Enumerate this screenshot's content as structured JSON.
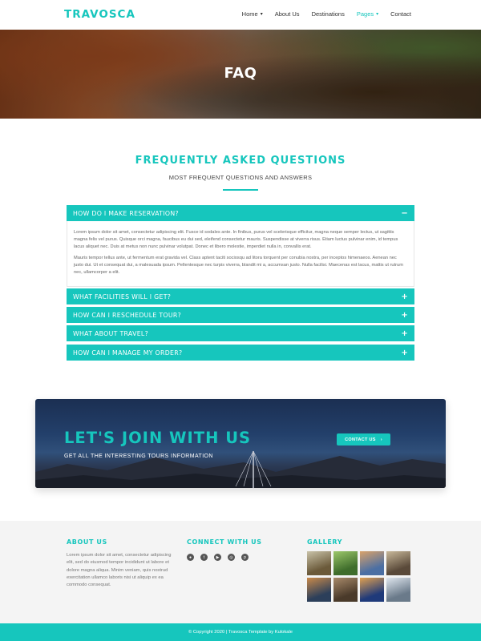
{
  "brand": {
    "logo": "TRAVOSCA",
    "accent": "#16c6bd"
  },
  "nav": {
    "items": [
      {
        "label": "Home",
        "caret": true,
        "active": false
      },
      {
        "label": "About Us",
        "caret": false,
        "active": false
      },
      {
        "label": "Destinations",
        "caret": false,
        "active": false
      },
      {
        "label": "Pages",
        "caret": true,
        "active": true
      },
      {
        "label": "Contact",
        "caret": false,
        "active": false
      }
    ]
  },
  "hero": {
    "title": "FAQ"
  },
  "faq": {
    "title": "FREQUENTLY ASKED QUESTIONS",
    "subtitle": "MOST FREQUENT QUESTIONS AND ANSWERS",
    "items": [
      {
        "question": "HOW DO I MAKE RESERVATION?",
        "sign": "−",
        "open": true,
        "answer_p1": "Lorem ipsum dolor sit amet, consectetur adipiscing elit. Fusce id sodales ante. In finibus, purus vel scelerisque efficitur, magna neque semper lectus, ut sagittis magna felis vel purus. Quisque orci magna, faucibus eu dui sed, eleifend consectetur mauris. Suspendisse at viverra risus. Etiam luctus pulvinar enim, id tempus lacus aliquet nec. Duis at metus non nunc pulvinar volutpat. Donec et libero molestie, imperdiet nulla in, convallis erat.",
        "answer_p2": "Mauris tempor tellus ante, ut fermentum erat gravida vel. Class aptent taciti sociosqu ad litora torquent per conubia nostra, per inceptos himenaeos. Aenean nec justo dui. Ut et consequat dui, a malesuada ipsum. Pellentesque nec turpis viverra, blandit mi a, accumsan justo. Nulla facilisi. Maecenas est lacus, mattis ut rutrum nec, ullamcorper a elit."
      },
      {
        "question": "WHAT FACILITIES WILL I GET?",
        "sign": "+"
      },
      {
        "question": "HOW CAN I RESCHEDULE TOUR?",
        "sign": "+"
      },
      {
        "question": "WHAT ABOUT TRAVEL?",
        "sign": "+"
      },
      {
        "question": "HOW CAN I MANAGE MY ORDER?",
        "sign": "+"
      }
    ]
  },
  "cta": {
    "title": "LET'S JOIN WITH US",
    "subtitle": "GET ALL THE INTERESTING TOURS INFORMATION",
    "button": "CONTACT US",
    "button_icon": "›"
  },
  "footer": {
    "about": {
      "heading": "ABOUT US",
      "text": "Lorem ipsum dolor sit amet, consectetur adipiscing elit, sed do eiusmod tempor incididunt ut labore et dolore magna aliqua. Minim veniam, quis nostrud exercitation ullamco laboris nisi ut aliquip ex ea commodo consequat."
    },
    "connect": {
      "heading": "CONNECT WITH US",
      "icons": [
        "dribbble-icon",
        "twitter-icon",
        "youtube-icon",
        "instagram-icon",
        "pinterest-icon"
      ]
    },
    "gallery": {
      "heading": "GALLERY",
      "thumbs": [
        {
          "c1": "#6b5a3a",
          "c2": "#c9c2a8"
        },
        {
          "c1": "#3f6d2c",
          "c2": "#9cc86a"
        },
        {
          "c1": "#4b6fa3",
          "c2": "#d9a26a"
        },
        {
          "c1": "#5a4a3a",
          "c2": "#c8b89a"
        },
        {
          "c1": "#2c3f5a",
          "c2": "#c98a4a"
        },
        {
          "c1": "#4a3a2a",
          "c2": "#a88a6a"
        },
        {
          "c1": "#1f3a7a",
          "c2": "#e0a050"
        },
        {
          "c1": "#6a7a8a",
          "c2": "#dfe6ee"
        }
      ]
    },
    "copyright": "© Copyright 2020 | Travosca Template by Kulokale"
  }
}
